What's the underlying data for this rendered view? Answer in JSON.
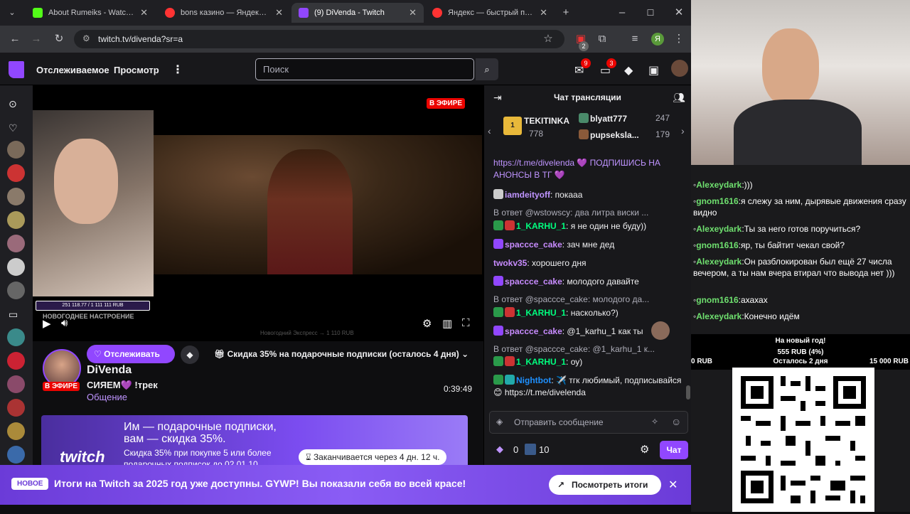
{
  "browser": {
    "tabs": [
      {
        "title": "About Rumeiks - Watch Li",
        "color": "#53fc18"
      },
      {
        "title": "bons казино — Яндекс: на",
        "color": "#ff3333"
      },
      {
        "title": "(9) DiVenda - Twitch",
        "color": "#9147ff"
      },
      {
        "title": "Яндекс — быстрый поиск",
        "color": "#ff3333"
      }
    ],
    "url": "twitch.tv/divenda?sr=a",
    "ext_badge": "2",
    "profile_letter": "Я"
  },
  "twitch_nav": {
    "following": "Отслеживаемое",
    "browse": "Просмотр",
    "more": "⋮",
    "search_placeholder": "Поиск",
    "inbox_count": "9",
    "whispers_count": "3"
  },
  "player": {
    "live_badge": "В ЭФИРЕ",
    "progress_text": "251 118.77 / 1 111 111 RUB",
    "overlay_text": "НОВОГОДНЕЕ НАСТРОЕНИЕ",
    "goal_text": "Новогодний Экспресс → 1 110 RUB"
  },
  "channel": {
    "follow_label": "Отслеживать",
    "promo": "Скидка 35% на подарочные подписки (осталось 4 дня)",
    "name": "DiVenda",
    "live_badge": "В ЭФИРЕ",
    "stream_title": "СИЯЕМ💜 !трек",
    "category": "Общение",
    "uptime": "0:39:49"
  },
  "banner": {
    "logo": "twitch",
    "headline_1": "Им — подарочные подписки,",
    "headline_2": "вам — скидка 35%.",
    "sub_1": "Скидка 35% при покупке 5 или более",
    "sub_2": "подарочных подписок до 02.01.10",
    "timer": "Заканчивается через 4 дн. 12 ч."
  },
  "chat": {
    "title": "Чат трансляции",
    "leader1": {
      "name": "TEKITINKA",
      "count": "778"
    },
    "leader2": {
      "name": "blyatt777",
      "count": "247"
    },
    "leader3": {
      "name": "pupseksla...",
      "count": "179"
    },
    "messages": [
      {
        "user": "",
        "color": "#bf94ff",
        "text": "https://t.me/divelenda 💜 ПОДПИШИСЬ НА АНОНСЫ В ТГ 💜"
      },
      {
        "user": "iamdeityoff",
        "color": "#bf94ff",
        "text": ": покааа"
      },
      {
        "reply": "В ответ @wstowscy: два литра виски ..."
      },
      {
        "user": "1_KARHU_1",
        "color": "#00ff7f",
        "text": ": я не один не буду))"
      },
      {
        "user": "spaccce_cake",
        "color": "#c88cff",
        "text": ": зач мне дед"
      },
      {
        "user": "twokv35",
        "color": "#c88cff",
        "text": ": хорошего дня"
      },
      {
        "user": "spaccce_cake",
        "color": "#c88cff",
        "text": ": молодого давайте"
      },
      {
        "reply": "В ответ @spaccce_cake: молодого да..."
      },
      {
        "user": "1_KARHU_1",
        "color": "#00ff7f",
        "text": ": насколько?)"
      },
      {
        "user": "spaccce_cake",
        "color": "#c88cff",
        "text": ": @1_karhu_1 как ты"
      },
      {
        "reply": "В ответ @spaccce_cake: @1_karhu_1 к..."
      },
      {
        "user": "1_KARHU_1",
        "color": "#00ff7f",
        "text": ": оу)"
      },
      {
        "user": "Nightbot",
        "color": "#1e90ff",
        "text": ": ✈️ тгк любимый, подписывайся 😊 https://t.me/divelenda"
      }
    ],
    "input_placeholder": "Отправить сообщение",
    "points": "0",
    "bits": "10",
    "chat_button": "Чат"
  },
  "bottom_bar": {
    "new_label": "НОВОЕ",
    "text": "Итоги на Twitch за 2025 год уже доступны. GYWP! Вы показали себя во всей красе!",
    "button": "Посмотреть итоги",
    "close": "✕"
  },
  "overlay_chat": [
    {
      "user": "Alexeydark",
      "text": ":)))"
    },
    {
      "user": "gnom1616",
      "text": ":я слежу за ним, дырявые движения сразу видно"
    },
    {
      "user": "Alexeydark",
      "text": ":Ты за него готов поручиться?"
    },
    {
      "user": "gnom1616",
      "text": ":яр, ты байтит чекал свой?"
    },
    {
      "user": "Alexeydark",
      "text": ":Он разблокирован был ещё 27 числа вечером, а ты нам вчера втирал что вывода нет )))"
    },
    {
      "user": "gnom1616",
      "text": ":ахахах"
    },
    {
      "user": "Alexeydark",
      "text": ":Конечно идём"
    }
  ],
  "donation_goal": {
    "title": "На новый год!",
    "amount": "555 RUB (4%)",
    "min": "0 RUB",
    "remaining": "Осталось 2 дня",
    "max": "15 000 RUB"
  }
}
